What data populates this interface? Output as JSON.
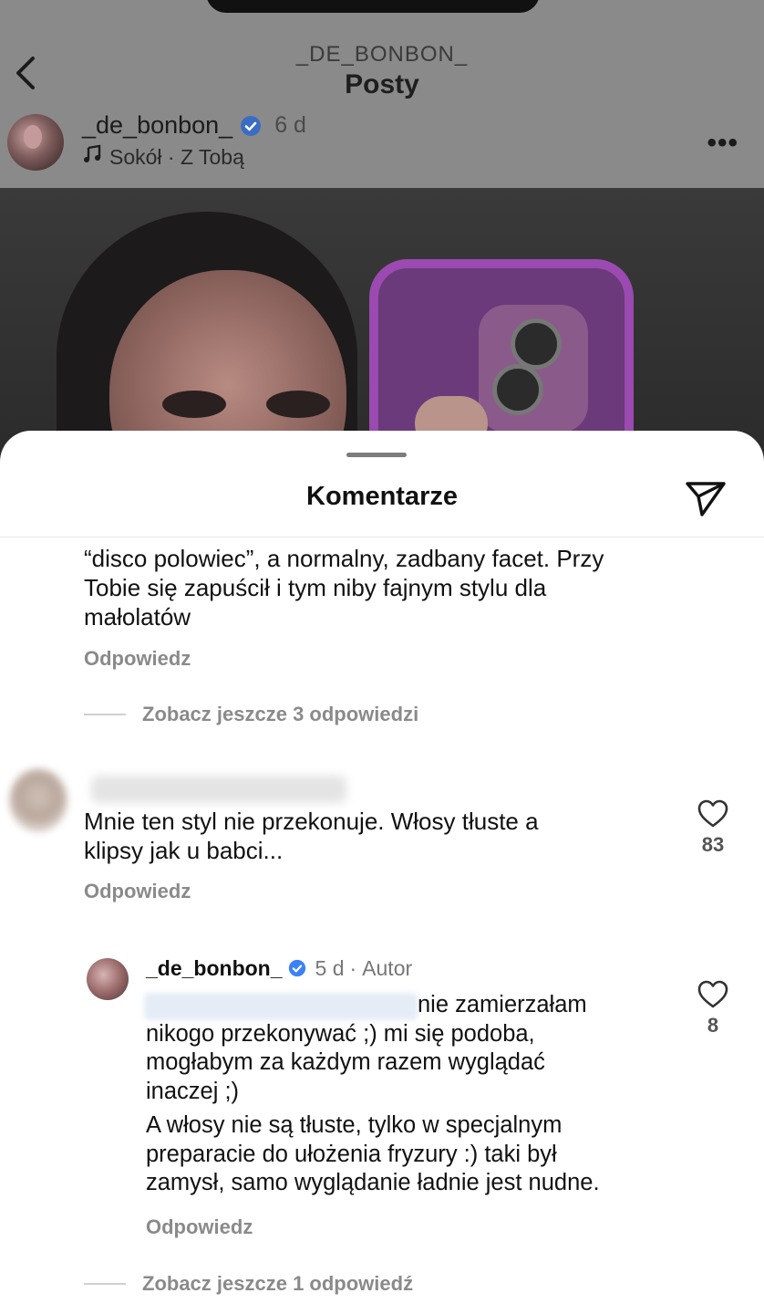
{
  "header": {
    "username": "_DE_BONBON_",
    "title": "Posty"
  },
  "post": {
    "username": "_de_bonbon_",
    "time": "6 d",
    "music": "Sokół · Z Tobą",
    "more_label": "•••"
  },
  "sheet": {
    "title": "Komentarze"
  },
  "comments": [
    {
      "text_lines": [
        "“disco polowiec”, a normalny, zadbany facet. Przy",
        "Tobie się zapuścił i tym niby fajnym stylu dla",
        "małolatów"
      ],
      "reply_label": "Odpowiedz",
      "view_more": "Zobacz jeszcze 3 odpowiedzi"
    },
    {
      "text_lines": [
        "Mnie ten styl nie przekonuje. Włosy tłuste a",
        "klipsy jak u babci..."
      ],
      "likes": "83",
      "reply_label": "Odpowiedz"
    },
    {
      "username": "_de_bonbon_",
      "time": "5 d",
      "badge": "Autor",
      "text_lines": [
        "nie zamierzałam",
        "nikogo przekonywać ;) mi się podoba,",
        "mogłabym za każdym razem wyglądać",
        "inaczej ;)",
        "A włosy nie są tłuste, tylko w specjalnym",
        "preparacie do ułożenia fryzury :) taki był",
        "zamysł, samo wyglądanie ładnie jest nudne."
      ],
      "likes": "8",
      "reply_label": "Odpowiedz",
      "view_more": "Zobacz jeszcze 1 odpowiedź"
    }
  ],
  "colors": {
    "verified": "#3b82f6",
    "overlay": "#8a8a8a",
    "meta_text": "#8a8a8a"
  }
}
